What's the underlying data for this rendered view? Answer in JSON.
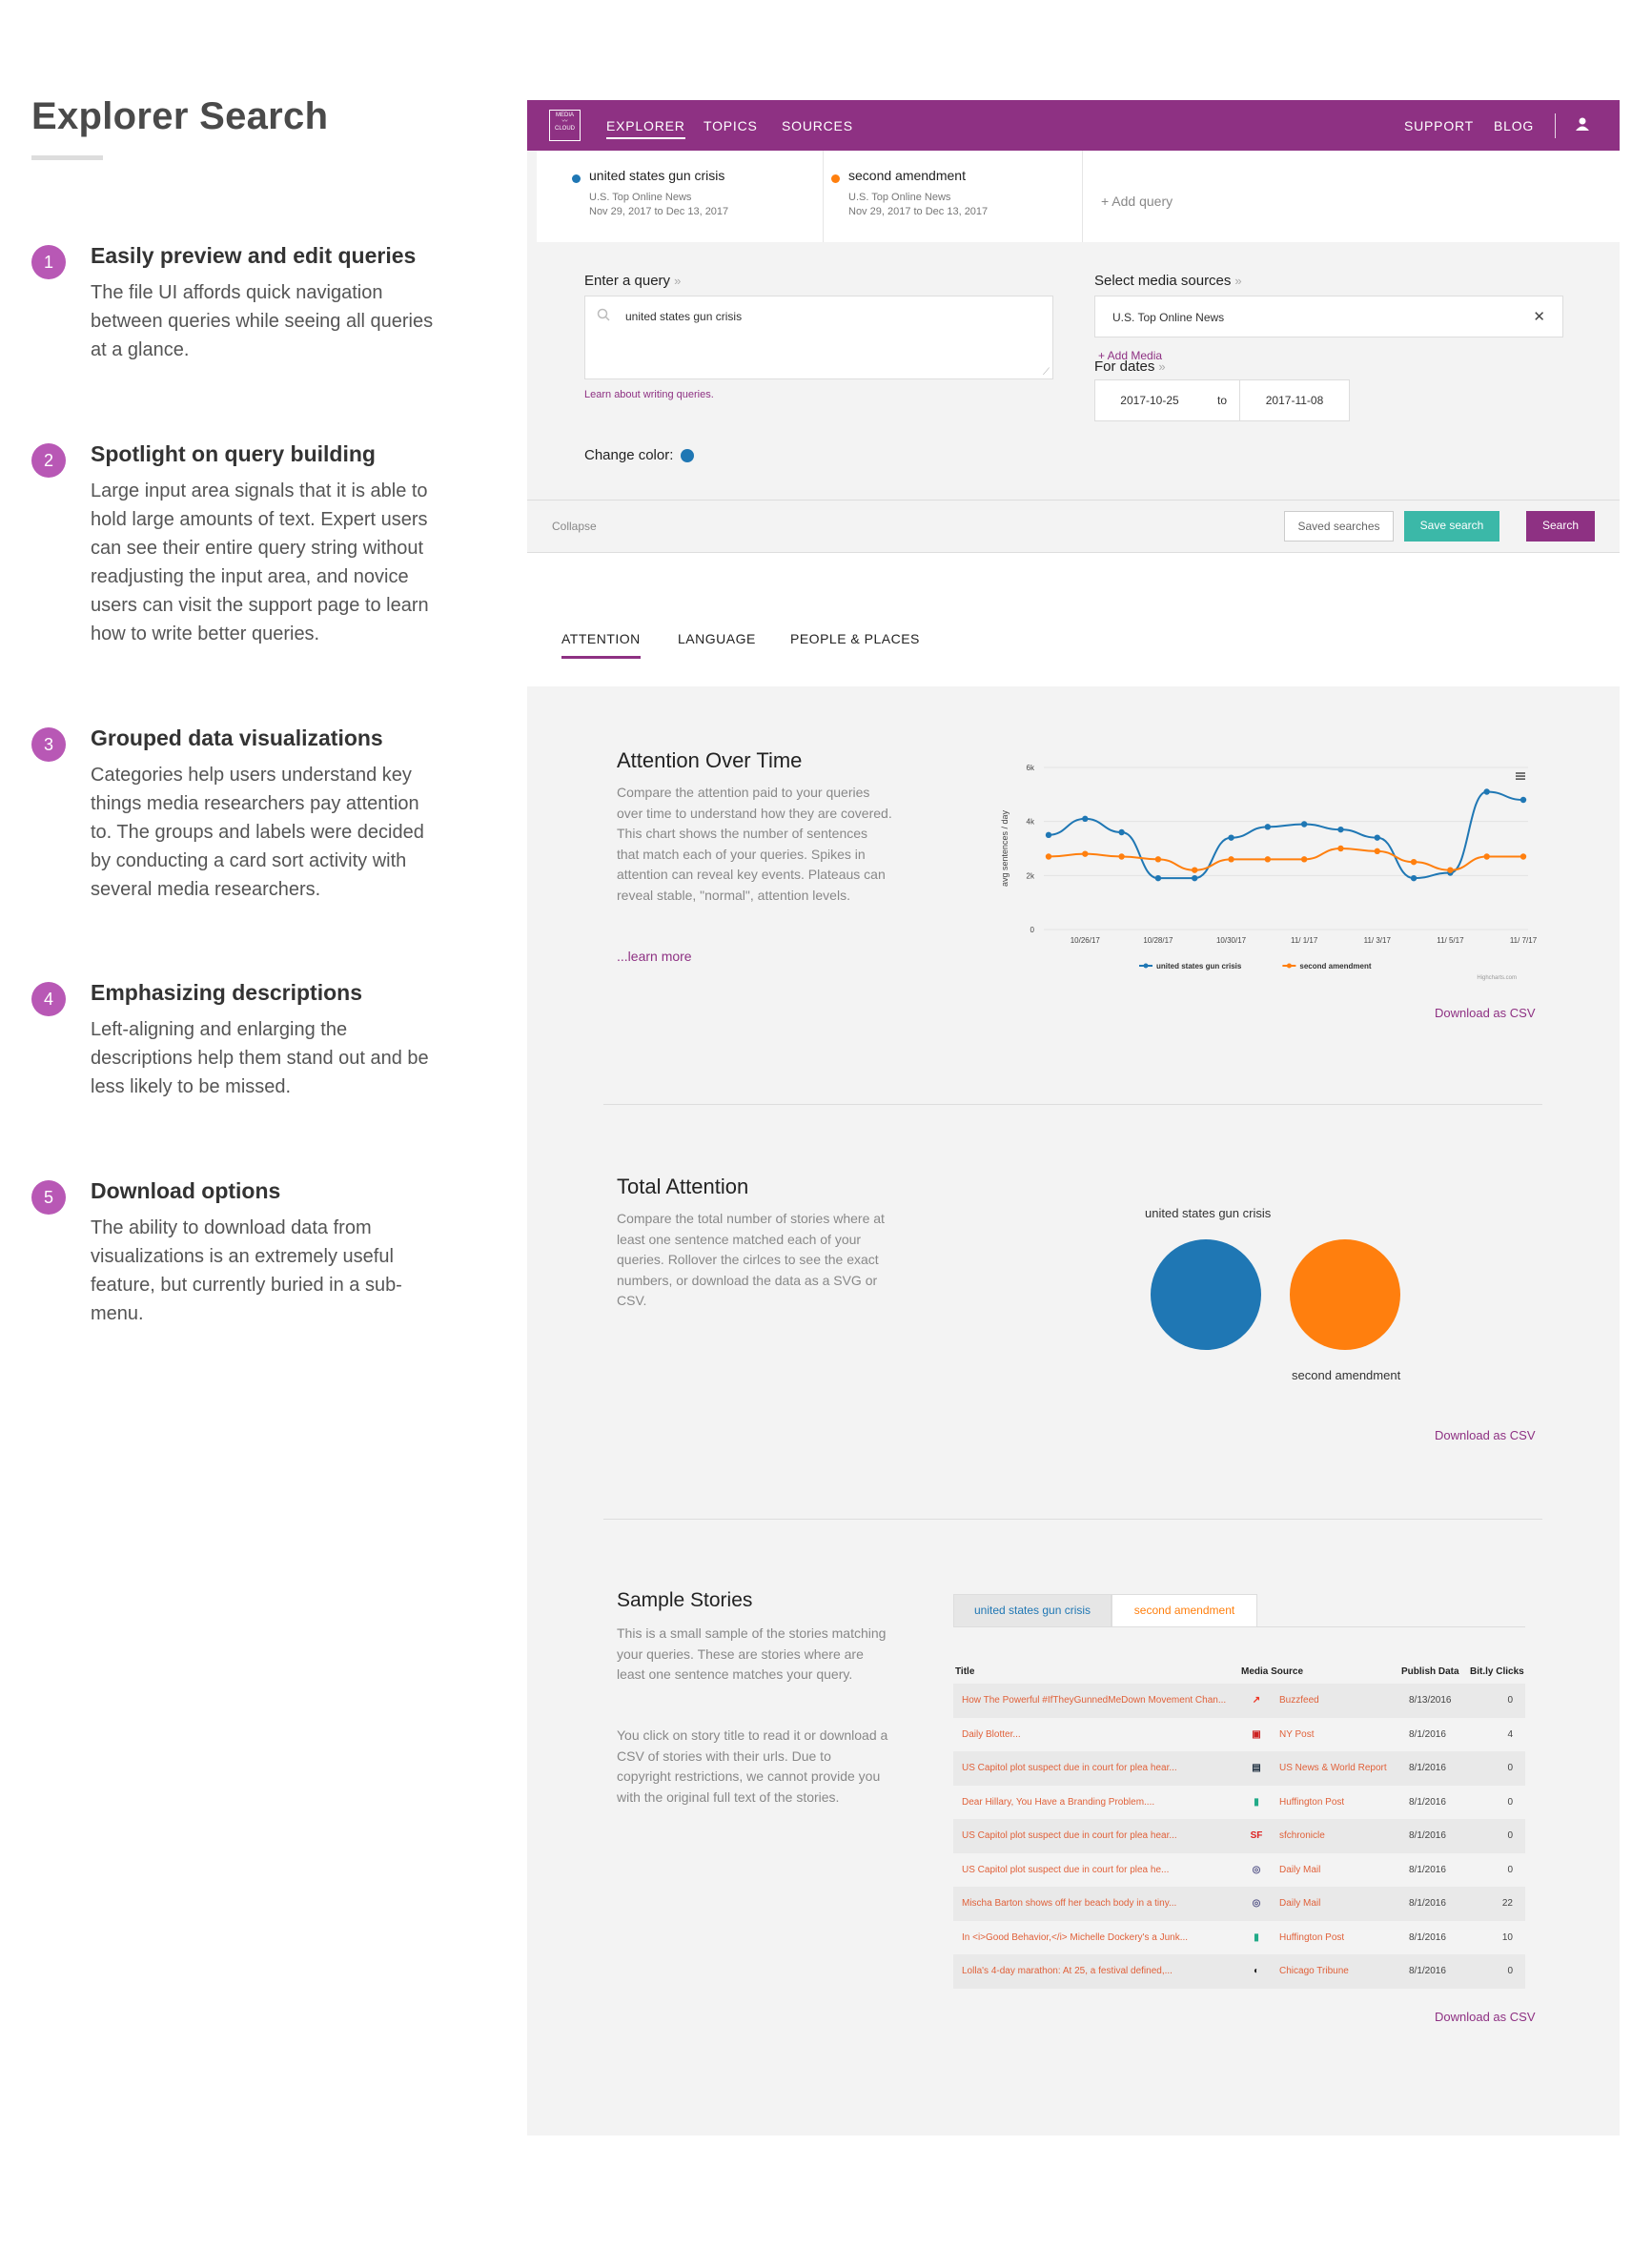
{
  "left_panel": {
    "title": "Explorer Search",
    "features": [
      {
        "num": "1",
        "title": "Easily preview and edit queries",
        "desc": "The file UI affords quick navigation between queries while seeing all queries at a glance."
      },
      {
        "num": "2",
        "title": "Spotlight on query building",
        "desc": "Large input area signals that it is able to hold large amounts of text. Expert users can see their entire query string without readjusting the input area, and novice users can visit the support page to learn how to write better queries."
      },
      {
        "num": "3",
        "title": "Grouped data visualizations",
        "desc": "Categories help users understand key things media researchers pay attention to. The groups and labels were decided by conducting a card sort activity with several media researchers."
      },
      {
        "num": "4",
        "title": "Emphasizing descriptions",
        "desc": "Left-aligning and enlarging the descriptions help them stand out and be less likely to be missed."
      },
      {
        "num": "5",
        "title": "Download options",
        "desc": "The ability to download data from visualizations is an extremely useful feature, but currently buried in a sub-menu."
      }
    ]
  },
  "nav": {
    "logo_text": "MEDIA CLOUD",
    "items": [
      "EXPLORER",
      "TOPICS",
      "SOURCES"
    ],
    "right_items": [
      "SUPPORT",
      "BLOG"
    ],
    "brand_color": "#8e3183"
  },
  "queries": [
    {
      "name": "united states gun crisis",
      "source": "U.S. Top Online News",
      "dates": "Nov 29, 2017 to Dec 13, 2017",
      "color": "#1f77b4"
    },
    {
      "name": "second amendment",
      "source": "U.S. Top Online News",
      "dates": "Nov 29, 2017 to Dec 13, 2017",
      "color": "#ff7f0e"
    }
  ],
  "add_query": "+ Add query",
  "builder": {
    "query_label": "Enter a query",
    "query_value": "united states gun crisis",
    "learn_link": "Learn about writing queries.",
    "color_label": "Change color:",
    "media_label": "Select media sources",
    "media_value": "U.S. Top Online News",
    "add_media": "+ Add Media",
    "dates_label": "For dates",
    "date_from": "2017-10-25",
    "date_to_word": "to",
    "date_to": "2017-11-08"
  },
  "footer": {
    "collapse": "Collapse",
    "saved": "Saved searches",
    "save": "Save search",
    "search": "Search"
  },
  "result_tabs": [
    "ATTENTION",
    "LANGUAGE",
    "PEOPLE & PLACES"
  ],
  "attention": {
    "title": "Attention Over Time",
    "desc": "Compare the attention paid to your queries over time to understand how they are covered. This chart shows the number of sentences that match each of your queries. Spikes in attention can reveal key events. Plateaus can reveal stable, \"normal\", attention levels.",
    "learn_more": "...learn more",
    "download": "Download as CSV",
    "credit": "Highcharts.com"
  },
  "total": {
    "title": "Total Attention",
    "desc": "Compare the total number of stories where at least one sentence matched each of your queries. Rollover the cirlces to see the exact numbers, or download the data as a SVG or CSV.",
    "download": "Download as CSV",
    "label1": "united states gun crisis",
    "label2": "second amendment"
  },
  "stories": {
    "title": "Sample Stories",
    "desc1": "This is a small sample of the stories matching your queries. These are stories where are least one sentence matches your query.",
    "desc2": "You click on story title to read it or download a CSV of stories with their urls. Due to copyright restrictions, we cannot provide you with the original full text of the stories.",
    "tabs": [
      "united states gun crisis",
      "second amendment"
    ],
    "headers": [
      "Title",
      "Media Source",
      "Publish Data",
      "Bit.ly Clicks"
    ],
    "rows": [
      {
        "title": "How The Powerful #IfTheyGunnedMeDown Movement Chan...",
        "source": "Buzzfeed",
        "date": "8/13/2016",
        "clicks": "0",
        "icon": "buzzfeed-icon"
      },
      {
        "title": "Daily Blotter...",
        "source": "NY Post",
        "date": "8/1/2016",
        "clicks": "4",
        "icon": "nypost-icon"
      },
      {
        "title": "US Capitol plot suspect due in court for plea hear...",
        "source": "US News & World Report",
        "date": "8/1/2016",
        "clicks": "0",
        "icon": "usnews-icon"
      },
      {
        "title": "Dear Hillary, You Have a Branding Problem....",
        "source": "Huffington Post",
        "date": "8/1/2016",
        "clicks": "0",
        "icon": "huffpost-icon"
      },
      {
        "title": "US Capitol plot suspect due in court for plea hear...",
        "source": "sfchronicle",
        "date": "8/1/2016",
        "clicks": "0",
        "icon": "sfchronicle-icon"
      },
      {
        "title": "US Capitol plot suspect due in court for plea he...",
        "source": "Daily Mail",
        "date": "8/1/2016",
        "clicks": "0",
        "icon": "dailymail-icon"
      },
      {
        "title": "Mischa Barton shows off her beach body in a tiny...",
        "source": "Daily Mail",
        "date": "8/1/2016",
        "clicks": "22",
        "icon": "dailymail-icon"
      },
      {
        "title": "In <i>Good Behavior,</i> Michelle Dockery's a Junk...",
        "source": "Huffington Post",
        "date": "8/1/2016",
        "clicks": "10",
        "icon": "huffpost-icon"
      },
      {
        "title": "Lolla's 4-day marathon: At 25, a festival defined,...",
        "source": "Chicago Tribune",
        "date": "8/1/2016",
        "clicks": "0",
        "icon": "chicagotribune-icon"
      }
    ],
    "download": "Download as CSV"
  },
  "chart_data": [
    {
      "type": "line",
      "title": "",
      "ylabel": "avg sentences / day",
      "ylim": [
        0,
        6000
      ],
      "yticks": [
        "0",
        "2k",
        "4k",
        "6k"
      ],
      "x_tick_labels": [
        "10/26/17",
        "10/28/17",
        "10/30/17",
        "11/ 1/17",
        "11/ 3/17",
        "11/ 5/17",
        "11/ 7/17"
      ],
      "x": [
        0,
        1,
        2,
        3,
        4,
        5,
        6,
        7,
        8,
        9,
        10,
        11,
        12,
        13
      ],
      "series": [
        {
          "name": "united states gun crisis",
          "color": "#1f77b4",
          "values": [
            3500,
            4100,
            3600,
            1900,
            1900,
            3400,
            3800,
            3900,
            3700,
            3400,
            1900,
            2100,
            5100,
            4800
          ]
        },
        {
          "name": "second amendment",
          "color": "#ff7f0e",
          "values": [
            2700,
            2800,
            2700,
            2600,
            2200,
            2600,
            2600,
            2600,
            3000,
            2900,
            2500,
            2200,
            2700,
            2700
          ]
        }
      ]
    },
    {
      "type": "bubble",
      "categories": [
        "united states gun crisis",
        "second amendment"
      ],
      "values": [
        1,
        1
      ]
    }
  ]
}
